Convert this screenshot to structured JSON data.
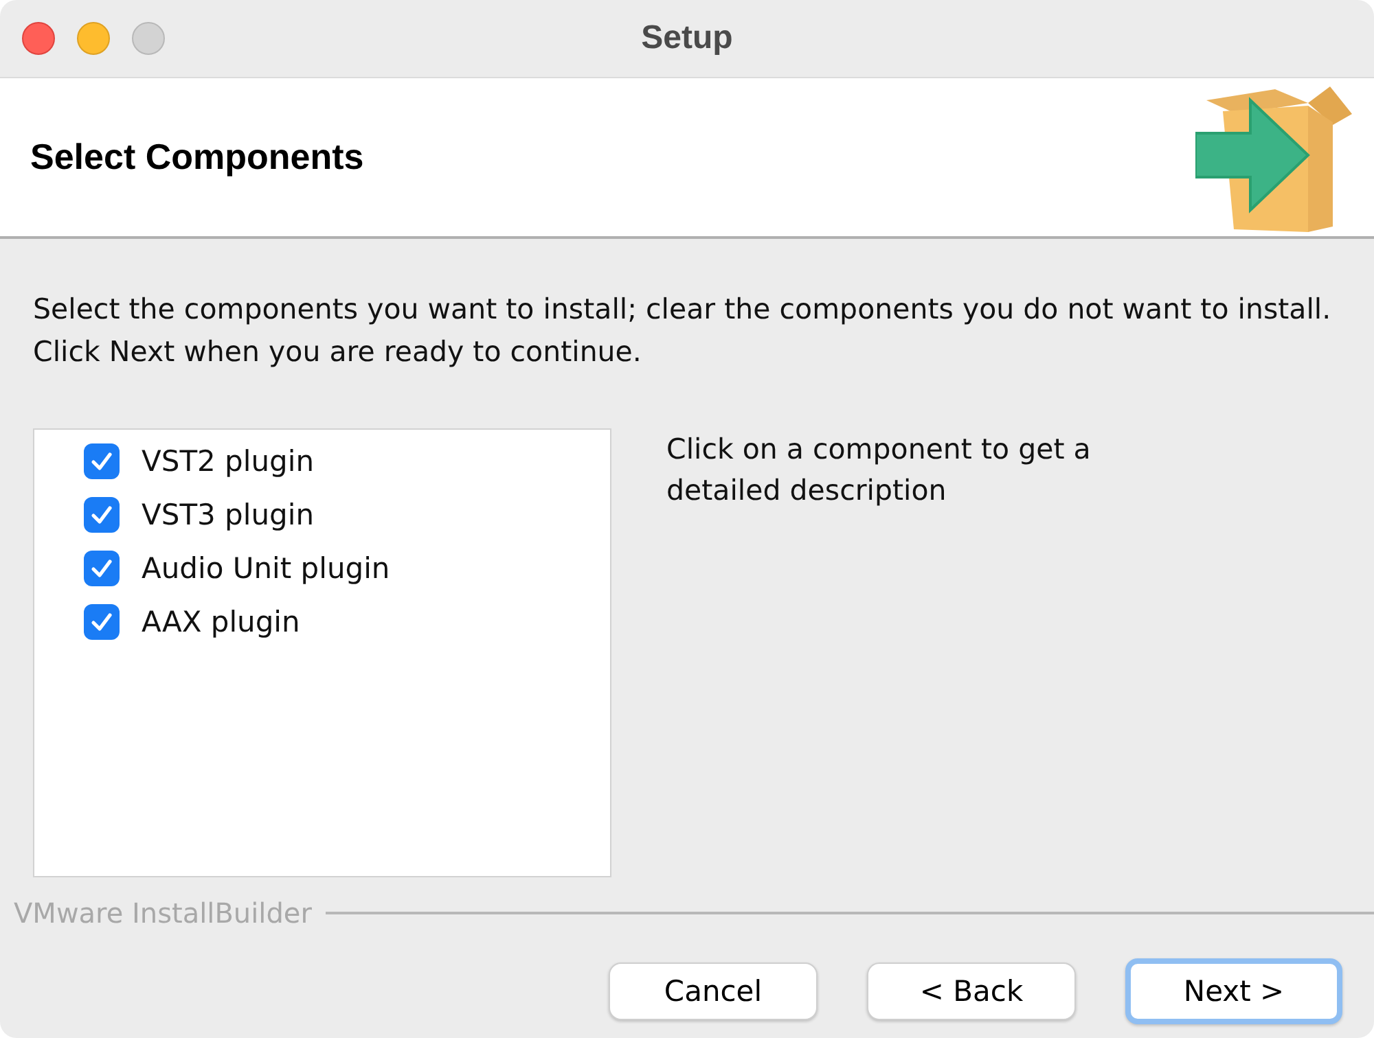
{
  "window": {
    "title": "Setup"
  },
  "header": {
    "title": "Select Components"
  },
  "instructions": "Select the components you want to install; clear the components you do not want to install. Click Next when you are ready to continue.",
  "components": [
    {
      "label": "VST2 plugin",
      "checked": true
    },
    {
      "label": "VST3 plugin",
      "checked": true
    },
    {
      "label": "Audio Unit plugin",
      "checked": true
    },
    {
      "label": "AAX plugin",
      "checked": true
    }
  ],
  "description": "Click on a component to get a detailed description",
  "branding": "VMware InstallBuilder",
  "buttons": [
    {
      "label": "Cancel",
      "focused": false
    },
    {
      "label": "< Back",
      "focused": false
    },
    {
      "label": "Next >",
      "focused": true
    }
  ]
}
